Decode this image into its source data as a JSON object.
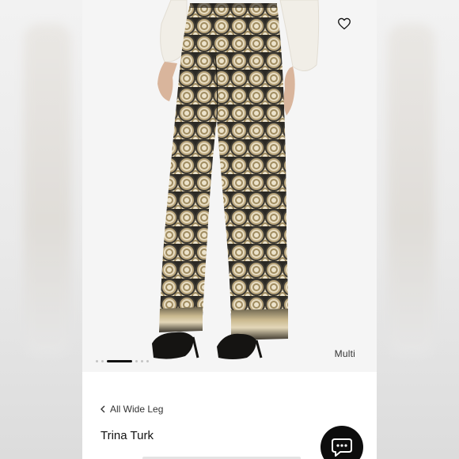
{
  "product": {
    "color_label": "Multi",
    "gallery": {
      "slide_count": 6,
      "active_index": 2
    },
    "back_link": "All Wide Leg",
    "brand": "Trina Turk"
  },
  "icons": {
    "favorite": "heart-icon",
    "back": "chevron-left-icon",
    "chat": "chat-bubble-icon"
  },
  "colors": {
    "accent": "#111111",
    "pattern_dark": "#2b2924",
    "pattern_gold": "#b8a47a",
    "pattern_cream": "#e7dcc2"
  }
}
